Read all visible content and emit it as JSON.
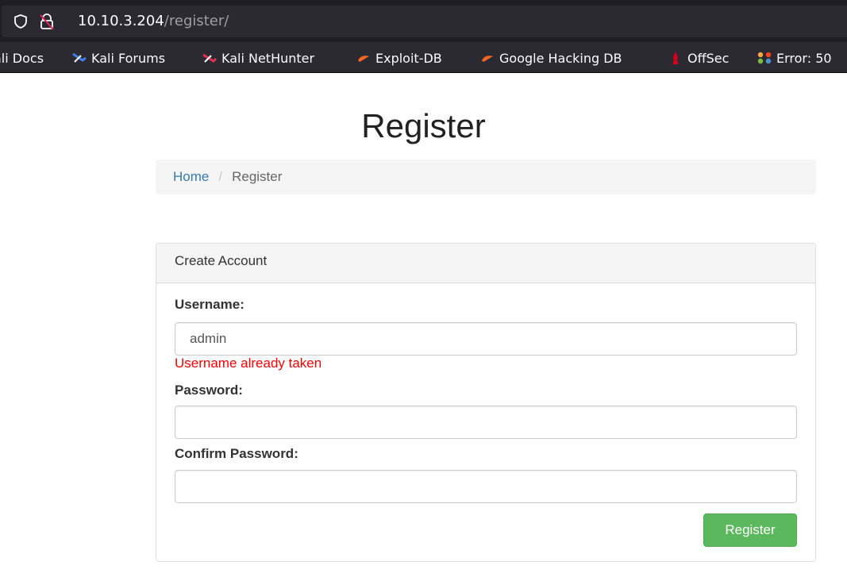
{
  "browser": {
    "url_host": "10.10.3.204",
    "url_path": "/register/",
    "bookmarks": [
      {
        "label": "ali Docs",
        "icon": "none"
      },
      {
        "label": "Kali Forums",
        "icon": "kali-forums-icon"
      },
      {
        "label": "Kali NetHunter",
        "icon": "kali-nethunter-icon"
      },
      {
        "label": "Exploit-DB",
        "icon": "exploit-db-icon"
      },
      {
        "label": "Google Hacking DB",
        "icon": "ghdb-icon"
      },
      {
        "label": "OffSec",
        "icon": "offsec-icon"
      },
      {
        "label": "Error: 50",
        "icon": "joomla-icon"
      }
    ]
  },
  "page": {
    "title": "Register",
    "breadcrumb": {
      "home": "Home",
      "separator": "/",
      "current": "Register"
    }
  },
  "form": {
    "heading": "Create Account",
    "username_label": "Username:",
    "username_value": "admin",
    "username_error": "Username already taken",
    "password_label": "Password:",
    "password_value": "",
    "confirm_label": "Confirm Password:",
    "confirm_value": "",
    "submit_label": "Register"
  },
  "colors": {
    "link": "#337ab7",
    "error": "#ff0000",
    "submit": "#5cb85c"
  }
}
